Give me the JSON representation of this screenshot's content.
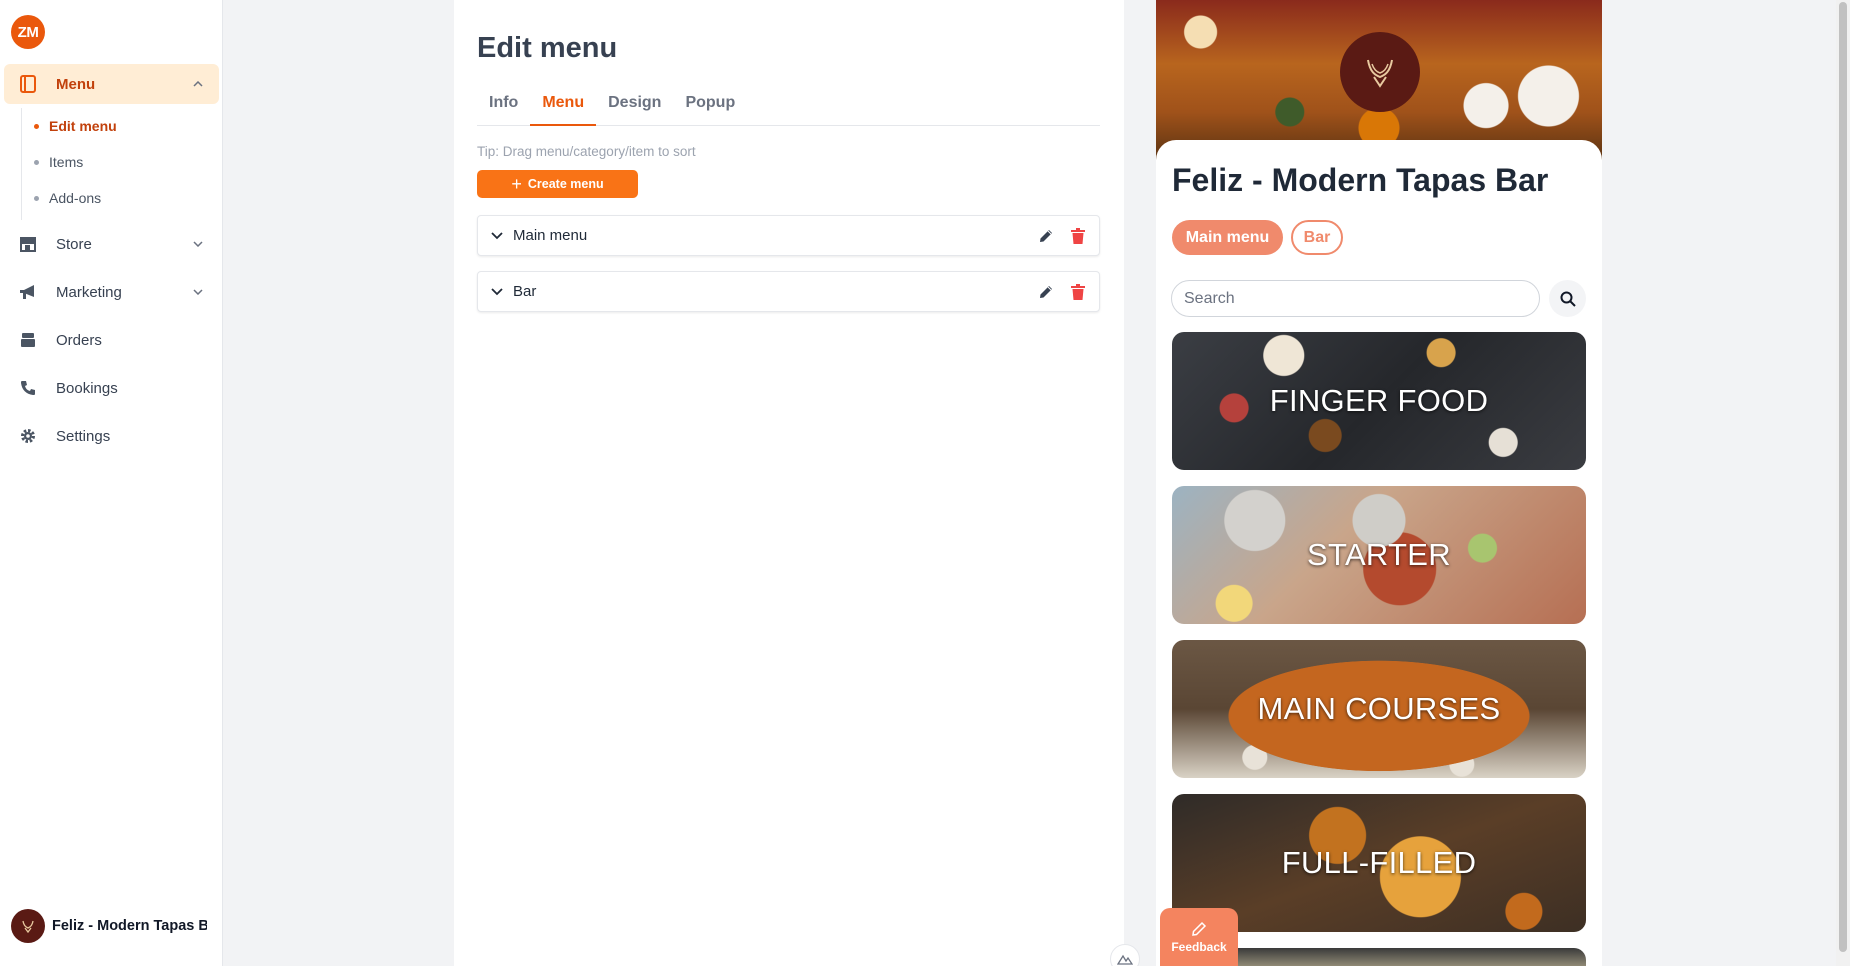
{
  "sidebar": {
    "logo_text": "ZM",
    "items": [
      {
        "label": "Menu",
        "icon": "book-icon"
      },
      {
        "label": "Store",
        "icon": "store-icon"
      },
      {
        "label": "Marketing",
        "icon": "megaphone-icon"
      },
      {
        "label": "Orders",
        "icon": "inbox-icon"
      },
      {
        "label": "Bookings",
        "icon": "phone-icon"
      },
      {
        "label": "Settings",
        "icon": "gear-icon"
      }
    ],
    "sub_items": [
      {
        "label": "Edit menu"
      },
      {
        "label": "Items"
      },
      {
        "label": "Add-ons"
      }
    ],
    "account_name": "Feliz - Modern Tapas Bar"
  },
  "main": {
    "title": "Edit menu",
    "tabs": [
      {
        "label": "Info"
      },
      {
        "label": "Menu"
      },
      {
        "label": "Design"
      },
      {
        "label": "Popup"
      }
    ],
    "active_tab": "Menu",
    "tip": "Tip: Drag menu/category/item to sort",
    "create_button": "Create menu",
    "menus": [
      {
        "label": "Main menu"
      },
      {
        "label": "Bar"
      }
    ]
  },
  "preview": {
    "store_name": "Feliz - Modern Tapas Bar",
    "menu_pills": [
      {
        "label": "Main menu",
        "selected": true
      },
      {
        "label": "Bar",
        "selected": false
      }
    ],
    "search_placeholder": "Search",
    "categories": [
      {
        "label": "FINGER FOOD"
      },
      {
        "label": "STARTER"
      },
      {
        "label": "MAIN COURSES"
      },
      {
        "label": "FULL-FILLED"
      },
      {
        "label": ""
      }
    ]
  },
  "feedback_label": "Feedback",
  "colors": {
    "accent": "#f97316",
    "accent_text": "#ea580c",
    "active_bg": "#ffedd5",
    "preview_pill": "#f08a6c",
    "delete": "#ef4444"
  }
}
